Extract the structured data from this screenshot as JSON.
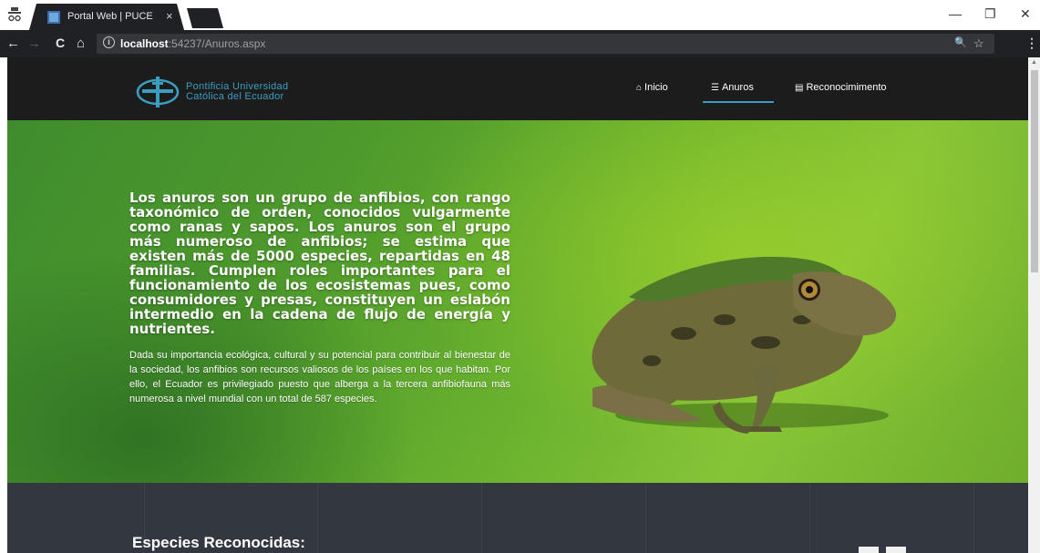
{
  "browser": {
    "tab_title": "Portal Web | PUCE",
    "tab_close": "×",
    "url_host": "localhost",
    "url_rest": ":54237/Anuros.aspx",
    "info_symbol": "i",
    "back": "←",
    "forward": "→",
    "reload": "C",
    "home": "⌂",
    "zoom": "🔍",
    "star": "☆",
    "menu": "⋮",
    "minimize": "—",
    "maximize": "❐",
    "close": "✕"
  },
  "site": {
    "logo_line1": "Pontificia Universidad",
    "logo_line2": "Católica del Ecuador",
    "nav": {
      "inicio": "Inicio",
      "anuros": "Anuros",
      "reconocimiento": "Reconocimimento"
    }
  },
  "hero": {
    "lead": "Los anuros son un grupo de anfibios, con rango taxonómico de orden, conocidos vulgarmente como ranas y sapos. Los anuros son el grupo más numeroso de anfibios; se estima que existen más de 5000 especies, repartidas en 48 familias. Cumplen roles importantes para el funcionamiento de los ecosistemas pues, como consumidores y presas, constituyen un eslabón intermedio en la cadena de flujo de energía y nutrientes.",
    "body": "Dada su importancia ecológica, cultural y su potencial para contribuir al bienestar de la sociedad, los anfibios son recursos valiosos de los países en los que habitan. Por ello, el Ecuador es privilegiado puesto que alberga a la tercera anfibiofauna más numerosa a nivel mundial con un total de 587 especies."
  },
  "species": {
    "title": "Especies Reconocidas:"
  },
  "colors": {
    "accent": "#3a9ec1",
    "nav_bg": "#1c1c1c",
    "hero_green": "#6ab22e",
    "species_bg": "#33373f"
  }
}
